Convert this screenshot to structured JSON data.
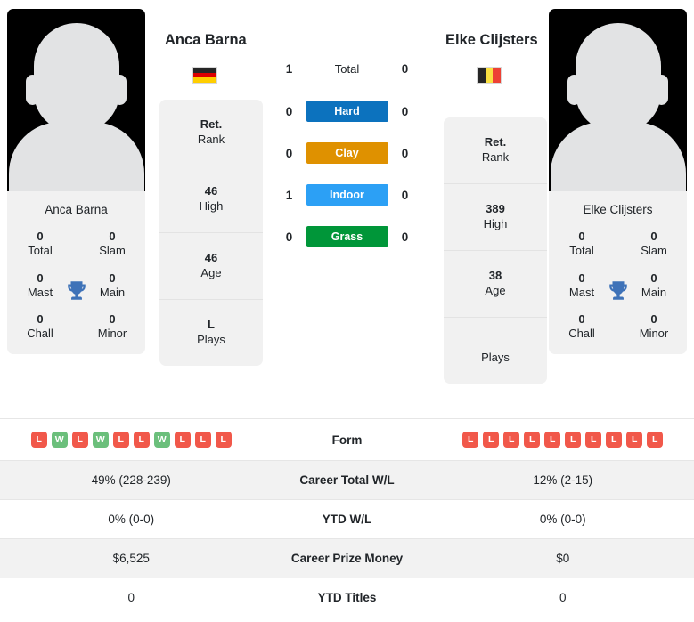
{
  "players": {
    "left": {
      "name": "Anca Barna",
      "caption": "Anca Barna",
      "flag_name": "germany-flag",
      "flag_orientation": "horizontal",
      "flag_colors": [
        "#262626",
        "#DD0000",
        "#FFCE00"
      ],
      "titles": {
        "total_val": "0",
        "total_lab": "Total",
        "slam_val": "0",
        "slam_lab": "Slam",
        "mast_val": "0",
        "mast_lab": "Mast",
        "main_val": "0",
        "main_lab": "Main",
        "chall_val": "0",
        "chall_lab": "Chall",
        "minor_val": "0",
        "minor_lab": "Minor"
      },
      "rank": {
        "rank_val": "Ret.",
        "rank_lab": "Rank",
        "high_val": "46",
        "high_lab": "High",
        "age_val": "46",
        "age_lab": "Age",
        "plays_val": "L",
        "plays_lab": "Plays"
      },
      "form": [
        "L",
        "W",
        "L",
        "W",
        "L",
        "L",
        "W",
        "L",
        "L",
        "L"
      ],
      "career_total_wl": "49% (228-239)",
      "ytd_wl": "0% (0-0)",
      "career_prize_money": "$6,525",
      "ytd_titles": "0"
    },
    "right": {
      "name": "Elke Clijsters",
      "caption": "Elke Clijsters",
      "flag_name": "belgium-flag",
      "flag_orientation": "vertical",
      "flag_colors": [
        "#262626",
        "#FAE042",
        "#ED4135"
      ],
      "titles": {
        "total_val": "0",
        "total_lab": "Total",
        "slam_val": "0",
        "slam_lab": "Slam",
        "mast_val": "0",
        "mast_lab": "Mast",
        "main_val": "0",
        "main_lab": "Main",
        "chall_val": "0",
        "chall_lab": "Chall",
        "minor_val": "0",
        "minor_lab": "Minor"
      },
      "rank": {
        "rank_val": "Ret.",
        "rank_lab": "Rank",
        "high_val": "389",
        "high_lab": "High",
        "age_val": "38",
        "age_lab": "Age",
        "plays_val": "",
        "plays_lab": "Plays"
      },
      "form": [
        "L",
        "L",
        "L",
        "L",
        "L",
        "L",
        "L",
        "L",
        "L",
        "L"
      ],
      "career_total_wl": "12% (2-15)",
      "ytd_wl": "0% (0-0)",
      "career_prize_money": "$0",
      "ytd_titles": "0"
    }
  },
  "h2h": {
    "rows": [
      {
        "label": "Total",
        "left": "1",
        "right": "0",
        "color": "",
        "plain": true
      },
      {
        "label": "Hard",
        "left": "0",
        "right": "0",
        "color": "#0C72BE",
        "plain": false
      },
      {
        "label": "Clay",
        "left": "0",
        "right": "0",
        "color": "#DF9100",
        "plain": false
      },
      {
        "label": "Indoor",
        "left": "1",
        "right": "0",
        "color": "#2CA0F5",
        "plain": false
      },
      {
        "label": "Grass",
        "left": "0",
        "right": "0",
        "color": "#009639",
        "plain": false
      }
    ]
  },
  "table": {
    "rows": [
      {
        "label": "Form",
        "type": "form"
      },
      {
        "label": "Career Total W/L",
        "type": "text",
        "key": "career_total_wl"
      },
      {
        "label": "YTD W/L",
        "type": "text",
        "key": "ytd_wl"
      },
      {
        "label": "Career Prize Money",
        "type": "text",
        "key": "career_prize_money"
      },
      {
        "label": "YTD Titles",
        "type": "text",
        "key": "ytd_titles"
      }
    ]
  },
  "colors": {
    "win_badge": "#6BBF7B",
    "loss_badge": "#F1584A",
    "card_bg": "#F1F1F1",
    "row_shade": "#F2F2F2",
    "trophy": "#3E72B8"
  },
  "icons": {
    "trophy": "trophy-icon"
  }
}
